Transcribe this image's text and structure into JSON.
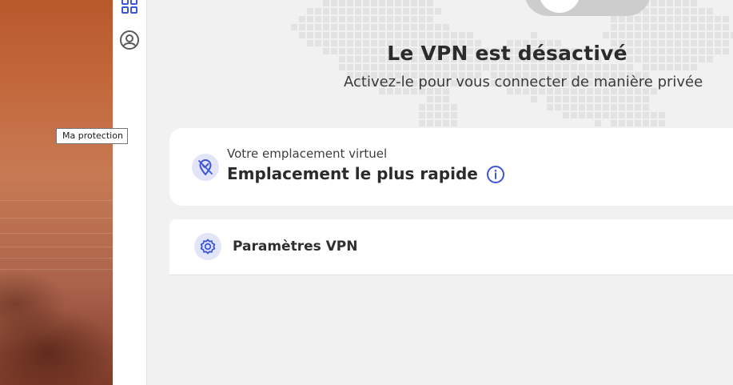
{
  "tooltip": {
    "text": "Ma protection"
  },
  "vpn": {
    "status_title": "Le VPN est désactivé",
    "status_subtitle": "Activez-le pour vous connecter de manière privée"
  },
  "location": {
    "label": "Votre emplacement virtuel",
    "value": "Emplacement le plus rapide"
  },
  "settings": {
    "label": "Paramètres VPN"
  },
  "sidebar": {
    "icons": [
      "grid-icon",
      "account-icon"
    ]
  },
  "colors": {
    "accent": "#3d55d6",
    "icon_background": "#e1e5f7",
    "toggle_off": "#cdcdcd",
    "main_background": "#f1f1f1"
  }
}
